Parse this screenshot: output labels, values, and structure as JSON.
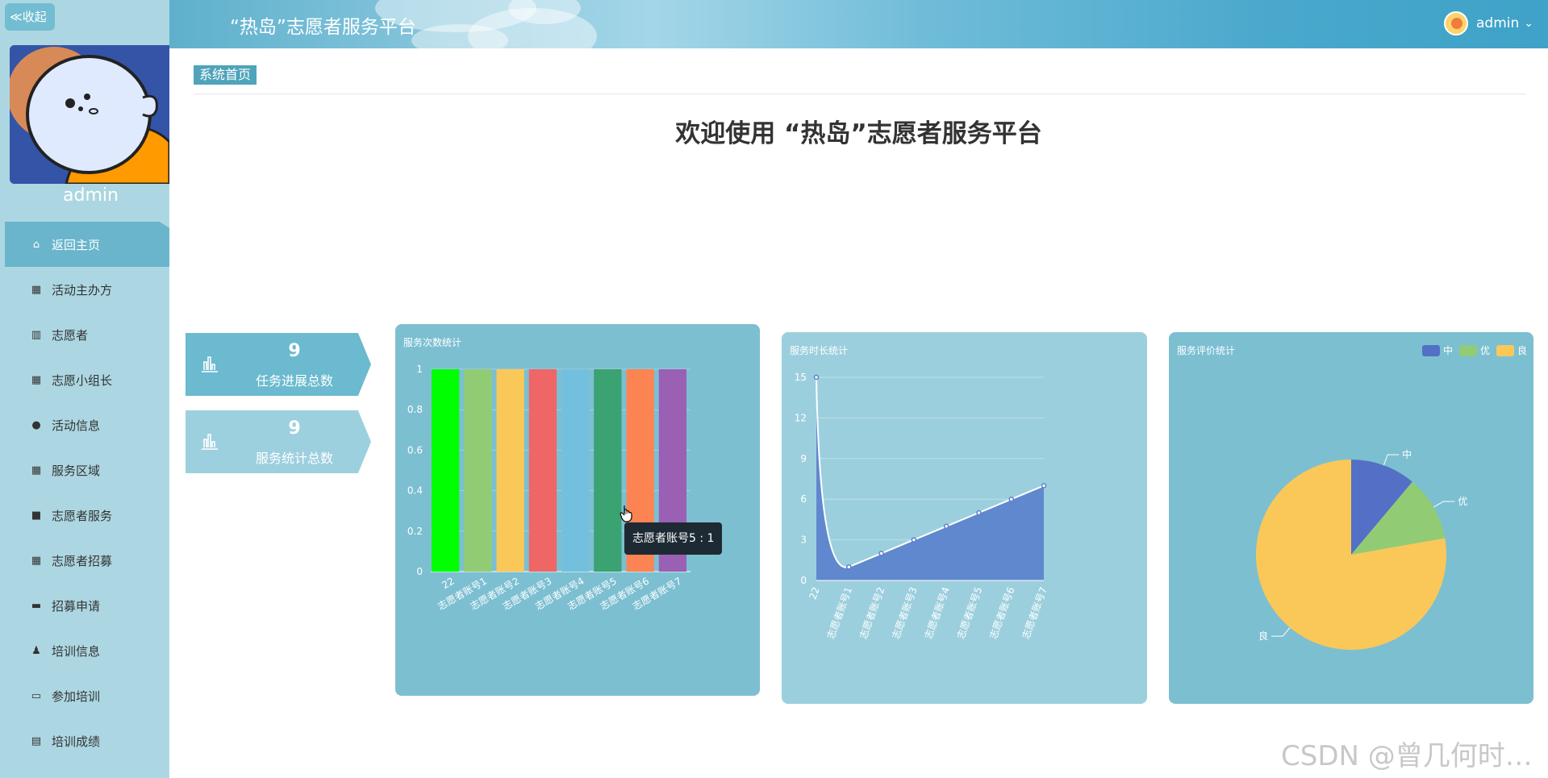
{
  "sidebar": {
    "collapse_label": "≪收起",
    "username": "admin",
    "items": [
      {
        "label": "返回主页",
        "icon": "home-icon",
        "glyph": "⌂"
      },
      {
        "label": "活动主办方",
        "icon": "grid-icon",
        "glyph": "▦"
      },
      {
        "label": "志愿者",
        "icon": "library-icon",
        "glyph": "▥"
      },
      {
        "label": "志愿小组长",
        "icon": "grid-icon",
        "glyph": "▦"
      },
      {
        "label": "活动信息",
        "icon": "bulb-icon",
        "glyph": "●"
      },
      {
        "label": "服务区域",
        "icon": "grid-icon",
        "glyph": "▦"
      },
      {
        "label": "志愿者服务",
        "icon": "video-icon",
        "glyph": "■"
      },
      {
        "label": "志愿者招募",
        "icon": "grid-icon",
        "glyph": "▦"
      },
      {
        "label": "招募申请",
        "icon": "briefcase-icon",
        "glyph": "▬"
      },
      {
        "label": "培训信息",
        "icon": "user-icon",
        "glyph": "♟"
      },
      {
        "label": "参加培训",
        "icon": "message-icon",
        "glyph": "▭"
      },
      {
        "label": "培训成绩",
        "icon": "clipboard-icon",
        "glyph": "▤"
      }
    ]
  },
  "header": {
    "title": "“热岛”志愿者服务平台",
    "username": "admin",
    "dropdown_glyph": "⌄"
  },
  "breadcrumb": "系统首页",
  "welcome": "欢迎使用 “热岛”志愿者服务平台",
  "stats": [
    {
      "value": "9",
      "label": "任务进展总数"
    },
    {
      "value": "9",
      "label": "服务统计总数"
    }
  ],
  "tooltip": "志愿者账号5 : 1",
  "watermark": "CSDN @曾几何时…",
  "colors": {
    "sidebar_bg": "#acd7e2",
    "sidebar_active": "#6ab5cc",
    "panel_bg": "#7cbfd1",
    "accent": "#4fa4ba"
  },
  "chart_data": [
    {
      "type": "bar",
      "title": "服务次数统计",
      "categories": [
        "22",
        "志愿者账号1",
        "志愿者账号2",
        "志愿者账号3",
        "志愿者账号4",
        "志愿者账号5",
        "志愿者账号6",
        "志愿者账号7"
      ],
      "values": [
        1,
        1,
        1,
        1,
        1,
        1,
        1,
        1
      ],
      "colors": [
        "#00ff00",
        "#91cc75",
        "#fac858",
        "#ee6666",
        "#73c0de",
        "#3ba272",
        "#fc8452",
        "#9a60b4"
      ],
      "yticks": [
        "0",
        "0.2",
        "0.4",
        "0.6",
        "0.8",
        "1"
      ],
      "ylim": [
        0,
        1
      ]
    },
    {
      "type": "area",
      "title": "服务时长统计",
      "categories": [
        "22",
        "志愿者账号1",
        "志愿者账号2",
        "志愿者账号3",
        "志愿者账号4",
        "志愿者账号5",
        "志愿者账号6",
        "志愿者账号7"
      ],
      "values": [
        15,
        1,
        2,
        3,
        4,
        5,
        6,
        7
      ],
      "color": "#5a7fcc",
      "yticks": [
        "0",
        "3",
        "6",
        "9",
        "12",
        "15"
      ],
      "ylim": [
        0,
        15
      ]
    },
    {
      "type": "pie",
      "title": "服务评价统计",
      "legend": [
        "中",
        "优",
        "良"
      ],
      "values": [
        1,
        1,
        7
      ],
      "colors": [
        "#5470c6",
        "#91cc75",
        "#fac858"
      ],
      "legend_position": "top-right"
    }
  ]
}
